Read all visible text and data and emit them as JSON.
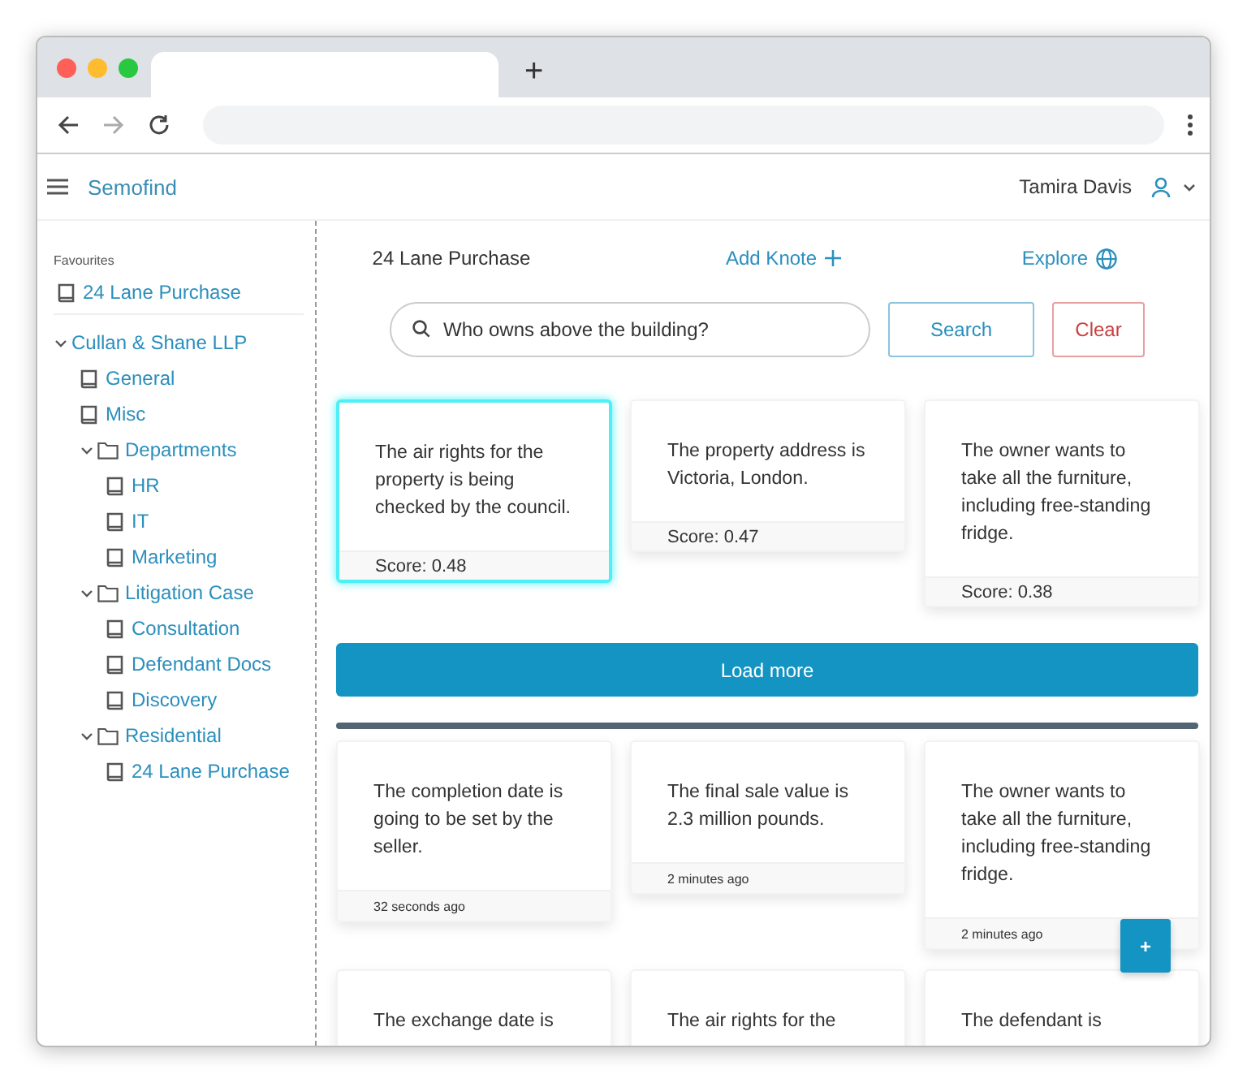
{
  "browser": {
    "new_tab": "+"
  },
  "app": {
    "brand": "Semofind",
    "user": "Tamira Davis"
  },
  "sidebar": {
    "section": "Favourites",
    "favourites": [
      {
        "label": "24 Lane Purchase"
      }
    ],
    "tree": [
      {
        "label": "Cullan & Shane LLP",
        "expanded": true,
        "children": [
          {
            "label": "General",
            "kind": "document"
          },
          {
            "label": "Misc",
            "kind": "document"
          },
          {
            "label": "Departments",
            "kind": "folder",
            "expanded": true,
            "children": [
              {
                "label": "HR",
                "kind": "document"
              },
              {
                "label": "IT",
                "kind": "document"
              },
              {
                "label": "Marketing",
                "kind": "document"
              }
            ]
          },
          {
            "label": "Litigation Case",
            "kind": "folder",
            "expanded": true,
            "children": [
              {
                "label": "Consultation",
                "kind": "document"
              },
              {
                "label": "Defendant Docs",
                "kind": "document"
              },
              {
                "label": "Discovery",
                "kind": "document"
              }
            ]
          },
          {
            "label": "Residential",
            "kind": "folder",
            "expanded": true,
            "children": [
              {
                "label": "24 Lane Purchase",
                "kind": "document"
              }
            ]
          }
        ]
      }
    ]
  },
  "toolbar": {
    "title": "24 Lane Purchase",
    "add": "Add Knote",
    "explore": "Explore"
  },
  "search": {
    "value": "Who owns above the building?",
    "search_button": "Search",
    "clear_button": "Clear"
  },
  "results": [
    {
      "text": "The air rights for the property is being checked by the council.",
      "footer": "Score: 0.48",
      "selected": true
    },
    {
      "text": "The property address is Victoria, London.",
      "footer": "Score: 0.47",
      "selected": false
    },
    {
      "text": "The owner wants to take all the furniture, including free-standing fridge.",
      "footer": "Score: 0.38",
      "selected": false
    }
  ],
  "load_more": "Load more",
  "knotes": [
    {
      "text": "The completion date is going to be set by the seller.",
      "footer": "32 seconds ago"
    },
    {
      "text": "The final sale value is 2.3 million pounds.",
      "footer": "2 minutes ago"
    },
    {
      "text": "The owner wants to take all the furniture, including free-standing fridge.",
      "footer": "2 minutes ago"
    },
    {
      "text": "The exchange date is"
    },
    {
      "text": "The air rights for the"
    },
    {
      "text": "The defendant is"
    }
  ],
  "fab": "+"
}
